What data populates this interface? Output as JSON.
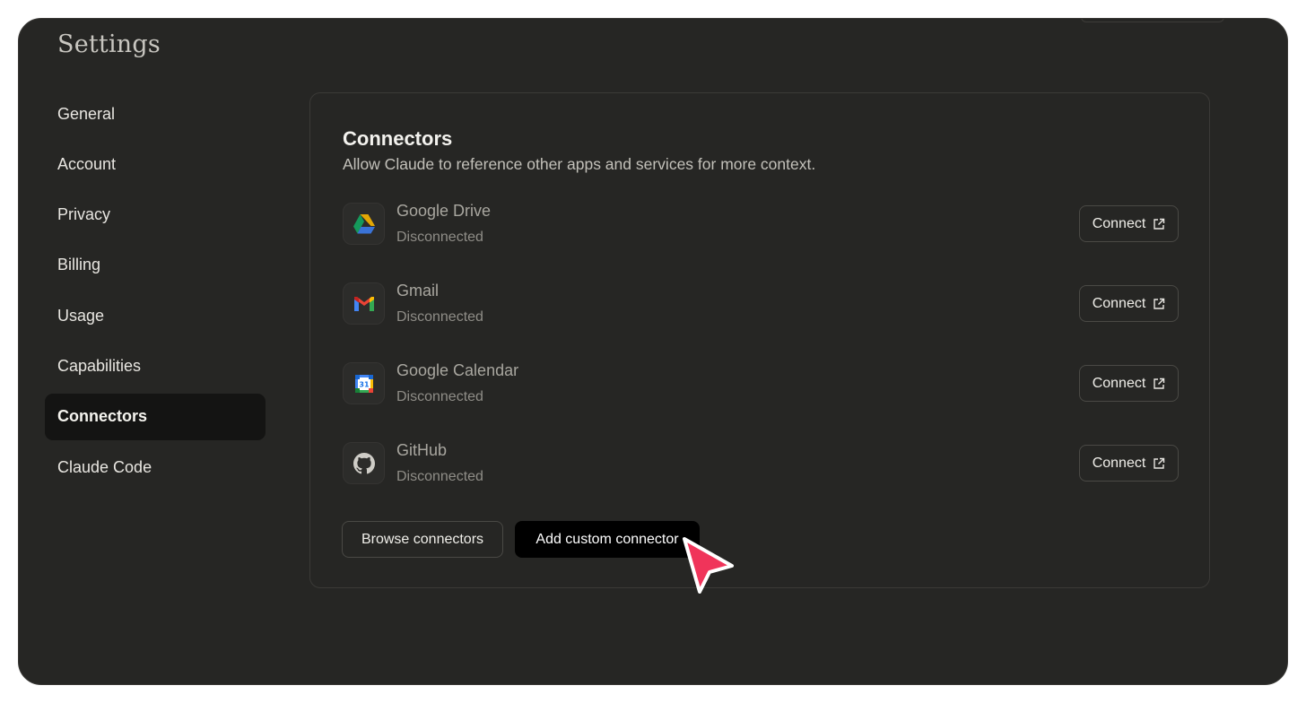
{
  "window": {
    "title": "Settings"
  },
  "sidebar": {
    "items": [
      {
        "label": "General",
        "active": false
      },
      {
        "label": "Account",
        "active": false
      },
      {
        "label": "Privacy",
        "active": false
      },
      {
        "label": "Billing",
        "active": false
      },
      {
        "label": "Usage",
        "active": false
      },
      {
        "label": "Capabilities",
        "active": false
      },
      {
        "label": "Connectors",
        "active": true
      },
      {
        "label": "Claude Code",
        "active": false
      }
    ]
  },
  "connectors": {
    "title": "Connectors",
    "subtitle": "Allow Claude to reference other apps and services for more context.",
    "items": [
      {
        "name": "Google Drive",
        "status": "Disconnected",
        "icon": "google-drive-icon",
        "action": "Connect"
      },
      {
        "name": "Gmail",
        "status": "Disconnected",
        "icon": "gmail-icon",
        "action": "Connect"
      },
      {
        "name": "Google Calendar",
        "status": "Disconnected",
        "icon": "google-calendar-icon",
        "action": "Connect",
        "icon_text": "31"
      },
      {
        "name": "GitHub",
        "status": "Disconnected",
        "icon": "github-icon",
        "action": "Connect"
      }
    ],
    "browse_label": "Browse connectors",
    "add_custom_label": "Add custom connector"
  },
  "colors": {
    "background": "#262624",
    "active_nav": "#141413",
    "cursor": "#f0345a"
  }
}
